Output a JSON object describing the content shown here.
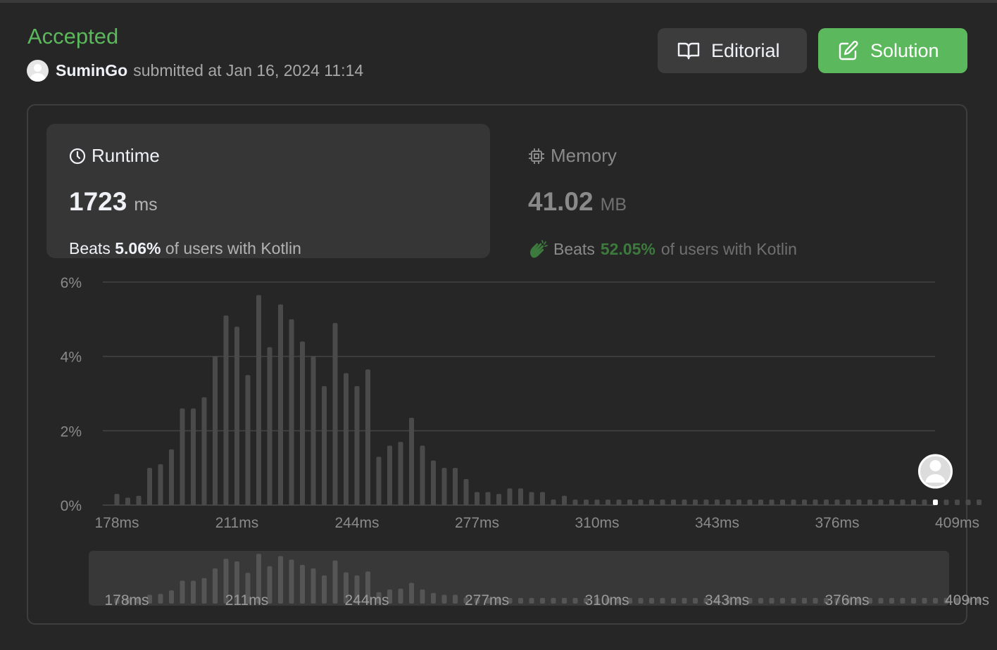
{
  "header": {
    "status": "Accepted",
    "username": "SuminGo",
    "submitted_text": "submitted at Jan 16, 2024 11:14"
  },
  "buttons": {
    "editorial": "Editorial",
    "solution": "Solution"
  },
  "runtime": {
    "title": "Runtime",
    "value": "1723",
    "unit": "ms",
    "beats_label": "Beats",
    "beats_pct": "5.06%",
    "beats_rest": "of users with Kotlin"
  },
  "memory": {
    "title": "Memory",
    "value": "41.02",
    "unit": "MB",
    "beats_label": "Beats",
    "beats_pct": "52.05%",
    "beats_rest": "of users with Kotlin"
  },
  "colors": {
    "accent_green": "#5cb85c",
    "bar": "#4a4a4a",
    "bar_highlight": "#ffffff"
  },
  "chart_data": {
    "type": "bar",
    "title": "",
    "xlabel": "",
    "ylabel": "",
    "ylim": [
      0,
      6
    ],
    "yticks": [
      "0%",
      "2%",
      "4%",
      "6%"
    ],
    "xticks": [
      "178ms",
      "211ms",
      "244ms",
      "277ms",
      "310ms",
      "343ms",
      "376ms",
      "409ms"
    ],
    "grid": true,
    "x_start_ms": 178,
    "bin_ms": 3,
    "values": [
      0.3,
      0.2,
      0.25,
      1.0,
      1.1,
      1.5,
      2.6,
      2.6,
      2.9,
      4.0,
      5.1,
      4.8,
      3.5,
      5.65,
      4.25,
      5.4,
      5.0,
      4.4,
      4.0,
      3.2,
      4.9,
      3.55,
      3.2,
      3.65,
      1.3,
      1.6,
      1.7,
      2.35,
      1.6,
      1.2,
      1.0,
      1.0,
      0.7,
      0.35,
      0.35,
      0.3,
      0.45,
      0.45,
      0.35,
      0.35,
      0.15,
      0.25,
      0.15,
      0.15,
      0.15,
      0.15,
      0.15,
      0.15,
      0.15,
      0.15,
      0.15,
      0.15,
      0.15,
      0.15,
      0.15,
      0.15,
      0.15,
      0.15,
      0.15,
      0.15,
      0.15,
      0.15,
      0.15,
      0.15,
      0.15,
      0.15,
      0.15,
      0.15,
      0.15,
      0.15,
      0.15,
      0.15,
      0.15,
      0.15,
      0.15,
      0.15,
      0.15,
      0.15,
      0.15,
      0.15
    ],
    "highlight_index": 75,
    "overview_xticks": [
      "178ms",
      "211ms",
      "244ms",
      "277ms",
      "310ms",
      "343ms",
      "376ms",
      "409ms"
    ]
  }
}
